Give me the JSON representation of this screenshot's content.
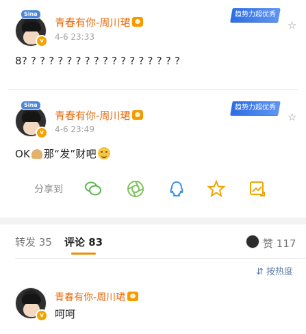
{
  "posts": [
    {
      "avatar_badge": "Sina",
      "author": "青春有你-周川珺",
      "timestamp": "4-6 23:33",
      "tag": "趋势力超优秀",
      "content": "8? ? ? ? ? ? ? ? ? ? ? ? ? ? ? ? ? ?"
    },
    {
      "avatar_badge": "Sina",
      "author": "青春有你-周川珺",
      "timestamp": "4-6 23:49",
      "tag": "趋势力超优秀",
      "content_prefix": "OK",
      "content_suffix": "那“发”财吧"
    }
  ],
  "share": {
    "label": "分享到",
    "targets": [
      "wechat-icon",
      "moments-icon",
      "weibo-icon",
      "qq-icon",
      "favorites-icon",
      "image-share-icon"
    ]
  },
  "tabs": {
    "repost_label": "转发",
    "repost_count": "35",
    "comment_label": "评论",
    "comment_count": "83",
    "like_label": "赞",
    "like_count": "117"
  },
  "sort": {
    "label": "按热度"
  },
  "comments": [
    {
      "author": "青春有你-周川珺",
      "text": "呵呵"
    }
  ]
}
